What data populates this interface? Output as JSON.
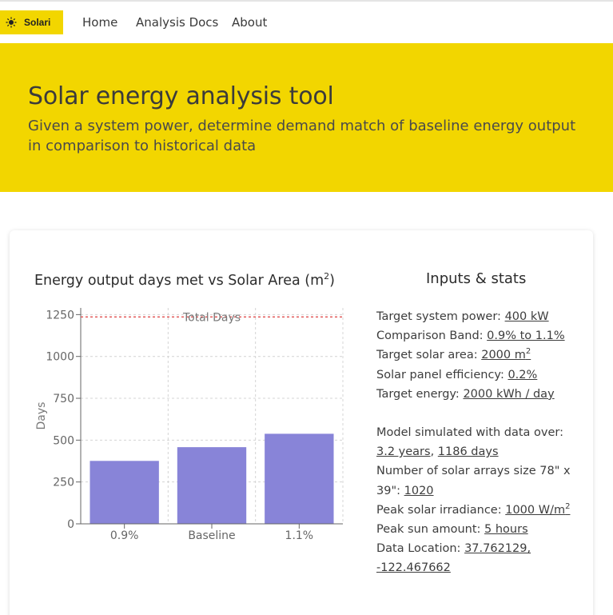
{
  "navbar": {
    "brand": "Solari",
    "links": [
      "Home",
      "Analysis Docs",
      "About"
    ]
  },
  "hero": {
    "title": "Solar energy analysis tool",
    "subtitle": "Given a system power, determine demand match of baseline energy output in comparison to historical data"
  },
  "chart": {
    "title": "Energy output days met vs Solar Area (m",
    "title_sup": "2",
    "title_close": ")"
  },
  "chart_data": {
    "type": "bar",
    "categories": [
      "0.9%",
      "Baseline",
      "1.1%"
    ],
    "values": [
      376,
      458,
      538
    ],
    "ylabel": "Days",
    "ylim": [
      0,
      1290
    ],
    "yticks": [
      0,
      250,
      500,
      750,
      1000,
      1250
    ],
    "reference_line": {
      "value": 1236,
      "label": "Total Days",
      "color": "#e05050"
    },
    "bar_color": "#8884d8",
    "grid": true
  },
  "stats": {
    "title": "Inputs & stats",
    "target_power_label": "Target system power: ",
    "target_power_value": "400 kW",
    "band_label": "Comparison Band: ",
    "band_value": "0.9% to 1.1%",
    "area_label": "Target solar area: ",
    "area_value": "2000 m",
    "area_sup": "2",
    "efficiency_label": "Solar panel efficiency: ",
    "efficiency_value": "0.2%",
    "energy_label": "Target energy: ",
    "energy_value": "2000 kWh / day",
    "simulated_label": "Model simulated with data over:",
    "years_value": "3.2 years",
    "comma": ", ",
    "days_value": "1186 days",
    "arrays_label": "Number of solar arrays size 78\" x 39\": ",
    "arrays_value": "1020",
    "irradiance_label": "Peak solar irradiance: ",
    "irradiance_value": "1000 W/m",
    "irradiance_sup": "2",
    "sun_label": "Peak sun amount: ",
    "sun_value": "5 hours",
    "location_label": "Data Location: ",
    "location_value": "37.762129, -122.467662"
  },
  "colors": {
    "brand_yellow": "#f2d600",
    "bar": "#8884d8",
    "reference": "#e05050"
  }
}
